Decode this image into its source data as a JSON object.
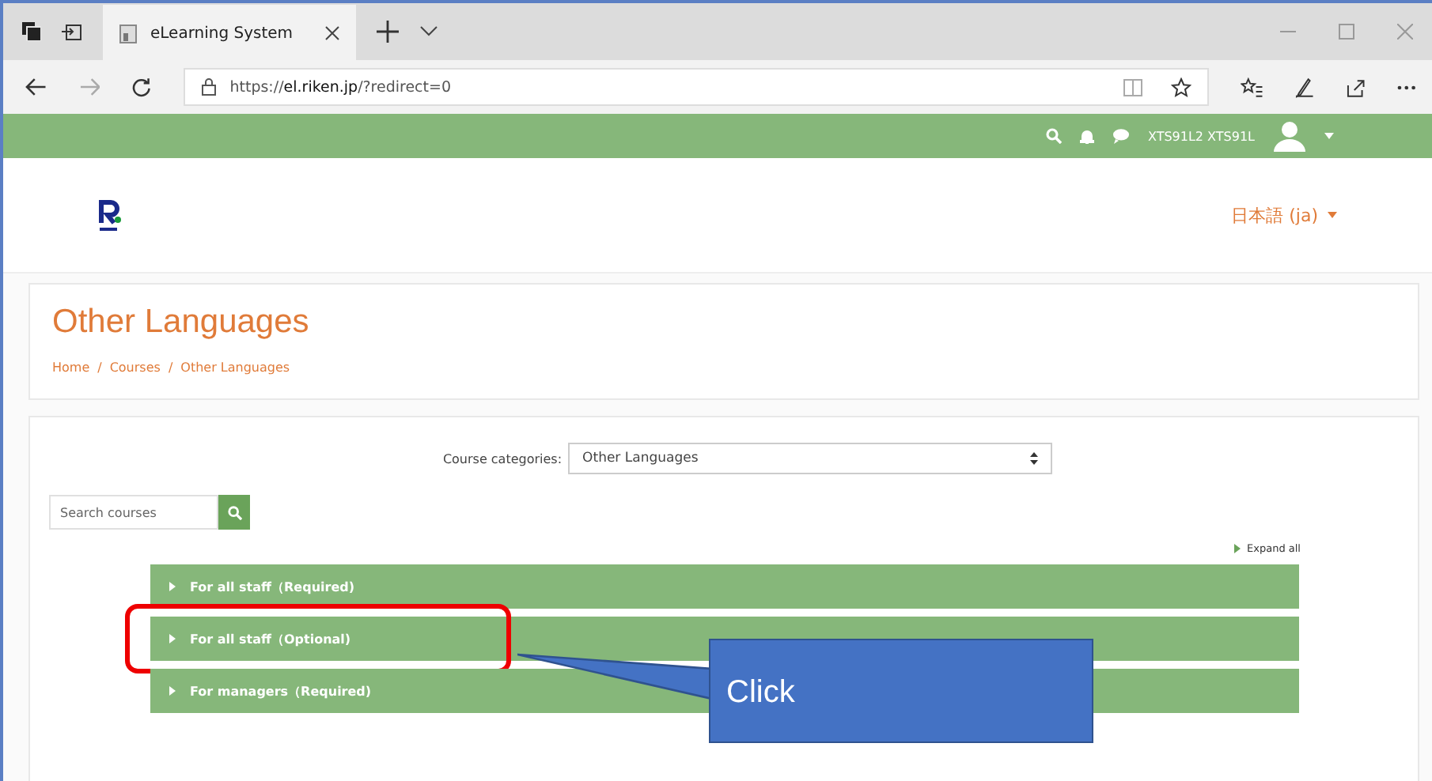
{
  "browser": {
    "tabs": [
      {
        "title": "eLearning System",
        "selected": true
      }
    ],
    "url_prefix": "https://",
    "url_host": "el.riken.jp",
    "url_path": "/?redirect=0"
  },
  "navbar": {
    "user_name": "XTS91L2 XTS91L"
  },
  "header": {
    "language": "日本語 (ja)"
  },
  "page_title": "Other Languages",
  "breadcrumb": [
    "Home",
    "Courses",
    "Other Languages"
  ],
  "breadcrumb_separators": [
    "/",
    "/"
  ],
  "course_categories": {
    "label": "Course categories:",
    "value": "Other Languages"
  },
  "search": {
    "placeholder": "Search courses"
  },
  "expand_all": "Expand all",
  "categories": [
    {
      "label": "For all staff（Required)",
      "highlighted": false
    },
    {
      "label": "For all staff（Optional)",
      "highlighted": true
    },
    {
      "label": "For managers（Required)",
      "highlighted": false
    }
  ],
  "callout": {
    "text": "Click"
  }
}
